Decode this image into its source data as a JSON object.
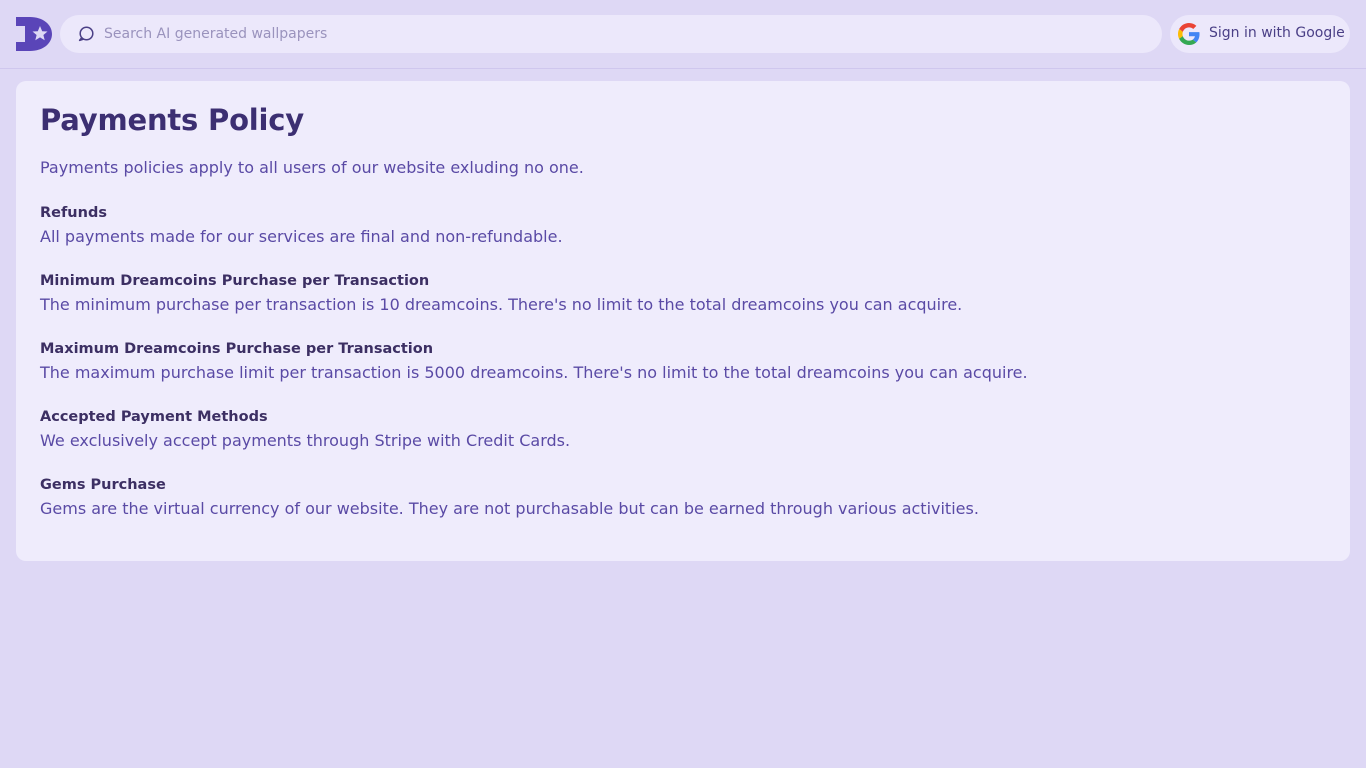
{
  "header": {
    "search_placeholder": "Search AI generated wallpapers",
    "signin_label": "Sign in with Google"
  },
  "main": {
    "title": "Payments Policy",
    "intro": "Payments policies apply to all users of our website exluding no one.",
    "sections": [
      {
        "heading": "Refunds",
        "body": "All payments made for our services are final and non-refundable."
      },
      {
        "heading": "Minimum Dreamcoins Purchase per Transaction",
        "body": "The minimum purchase per transaction is 10 dreamcoins. There's no limit to the total dreamcoins you can acquire."
      },
      {
        "heading": "Maximum Dreamcoins Purchase per Transaction",
        "body": "The maximum purchase limit per transaction is 5000 dreamcoins. There's no limit to the total dreamcoins you can acquire."
      },
      {
        "heading": "Accepted Payment Methods",
        "body": "We exclusively accept payments through Stripe with Credit Cards."
      },
      {
        "heading": "Gems Purchase",
        "body": "Gems are the virtual currency of our website. They are not purchasable but can be earned through various activities."
      }
    ]
  },
  "icons": {
    "logo": "dream-logo-icon",
    "search": "search-icon",
    "google": "google-icon"
  },
  "colors": {
    "page_background": "#ded8f5",
    "card_background": "#efecfc",
    "brand": "#5a45b8",
    "heading_text": "#3c2f72",
    "body_text": "#5a4aa5"
  }
}
